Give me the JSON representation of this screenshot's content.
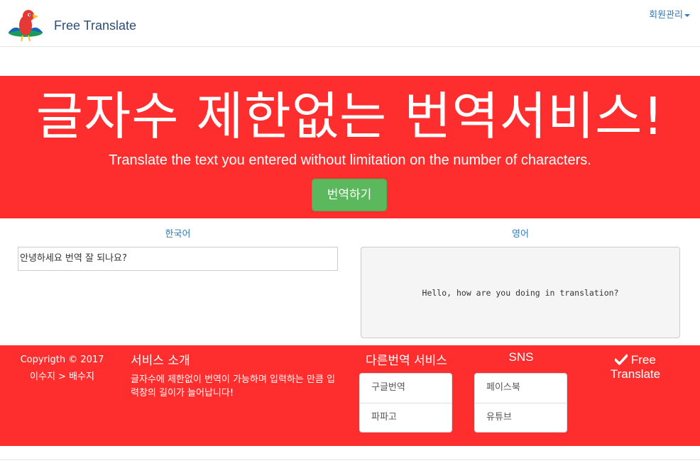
{
  "navbar": {
    "brand": "Free Translate",
    "member_menu": "회원관리",
    "logo_icon": "parrot-logo-icon"
  },
  "hero": {
    "title": "글자수 제한없는 번역서비스!",
    "subtitle": "Translate the text you entered without limitation on the number of characters.",
    "translate_button": "번역하기"
  },
  "translator": {
    "source_label": "한국어",
    "target_label": "영어",
    "source_text": "안녕하세요 번역 잘 되나요?",
    "result_text": "Hello, how are you doing in translation?"
  },
  "footer": {
    "copyright": "Copyrigth © 2017",
    "authors": "이수지 > 배수지",
    "about_title": "서비스 소개",
    "about_text": "글자수에 제한없이 번역이 가능하며 입력하는 만큼 입력창의 길이가 늘어납니다!",
    "other_title": "다른번역 서비스",
    "other_items": [
      "구글번역",
      "파파고"
    ],
    "sns_title": "SNS",
    "sns_items": [
      "페이스북",
      "유튜브"
    ],
    "brand_line1": "Free",
    "brand_line2": "Translate"
  },
  "colors": {
    "accent_red": "#ff2e2e",
    "button_green": "#5cb85c",
    "link_blue": "#337ab7"
  }
}
